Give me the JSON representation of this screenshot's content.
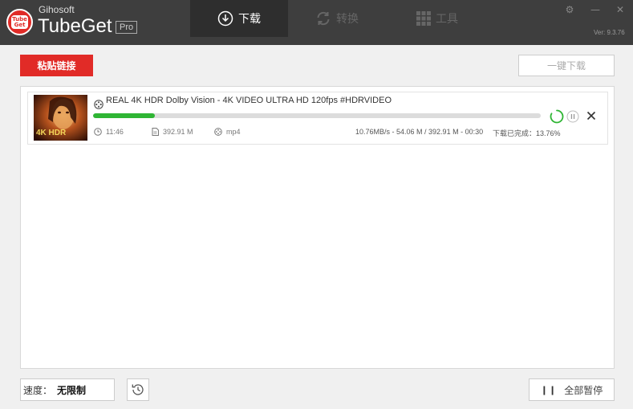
{
  "app": {
    "brand_small": "Gihosoft",
    "brand_name": "TubeGet",
    "edition": "Pro",
    "logo_text_top": "Tube",
    "logo_text_bottom": "Get",
    "version": "Ver: 9.3.76",
    "accent_color": "#e12b27"
  },
  "tabs": [
    {
      "label": "下载",
      "icon": "download-icon",
      "active": true
    },
    {
      "label": "转换",
      "icon": "convert-icon",
      "active": false
    },
    {
      "label": "工具",
      "icon": "grid-icon",
      "active": false
    }
  ],
  "window_controls": {
    "settings": "⚙",
    "minimize": "—",
    "close": "✕"
  },
  "toolbar": {
    "paste_label": "粘贴链接",
    "one_key_label": "一键下载"
  },
  "downloads": [
    {
      "thumbnail_label": "4K HDR",
      "title": "REAL 4K HDR Dolby Vision - 4K VIDEO ULTRA HD 120fps #HDRVIDEO",
      "duration": "11:46",
      "size": "392.91 M",
      "format": "mp4",
      "progress": 0.1376,
      "speed_info": "10.76MB/s - 54.06 M / 392.91 M - 00:30",
      "status": "下载已完成：13.76%",
      "progress_color": "#2fb534"
    }
  ],
  "bottom": {
    "speed_label": "速度：",
    "speed_value": "无限制",
    "pause_all_label": "全部暂停"
  }
}
